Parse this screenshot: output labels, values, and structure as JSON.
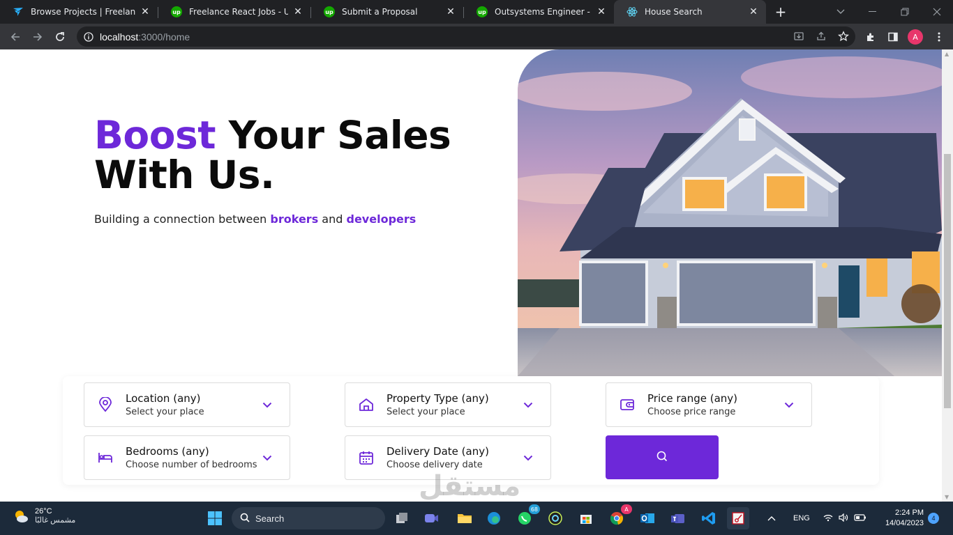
{
  "browser": {
    "tabs": [
      {
        "title": "Browse Projects | Freelancer",
        "icon": "freelancer-icon"
      },
      {
        "title": "Freelance React Jobs - Upwo",
        "icon": "upwork-icon"
      },
      {
        "title": "Submit a Proposal",
        "icon": "upwork-icon"
      },
      {
        "title": "Outsystems Engineer - Web",
        "icon": "upwork-icon"
      },
      {
        "title": "House Search",
        "icon": "react-icon",
        "active": true
      }
    ],
    "upwork_glyph": "up",
    "tab_close_glyph": "✕",
    "new_tab_glyph": "+",
    "url_host": "localhost",
    "url_rest": ":3000/home",
    "profile_initial": "A"
  },
  "hero": {
    "title_accent": "Boost",
    "title_rest_line1": " Your Sales",
    "title_line2": "With Us.",
    "subtitle_part1": "Building a connection between ",
    "subtitle_highlight1": "brokers",
    "subtitle_part2": " and ",
    "subtitle_highlight2": "developers"
  },
  "search": {
    "fields": [
      {
        "label": "Location (any)",
        "sub": "Select your place",
        "icon": "location-pin-icon"
      },
      {
        "label": "Property Type (any)",
        "sub": "Select your place",
        "icon": "house-icon"
      },
      {
        "label": "Price range (any)",
        "sub": "Choose price range",
        "icon": "wallet-icon"
      },
      {
        "label": "Bedrooms (any)",
        "sub": "Choose number of bedrooms",
        "icon": "bed-icon"
      },
      {
        "label": "Delivery Date (any)",
        "sub": "Choose delivery date",
        "icon": "calendar-icon"
      }
    ],
    "button_icon": "search-icon"
  },
  "watermark": "مستقل",
  "taskbar": {
    "weather_temp": "26°C",
    "weather_cond": "مشمس غالبًا",
    "search_label": "Search",
    "whatsapp_badge": "68",
    "chrome_badge": "A",
    "lang": "ENG",
    "time": "2:24 PM",
    "date": "14/04/2023",
    "notification_count": "4"
  },
  "colors": {
    "accent": "#6d28d9",
    "chrome_dark": "#202124",
    "chrome_toolbar": "#35363a",
    "taskbar": "#1c2a3a"
  }
}
